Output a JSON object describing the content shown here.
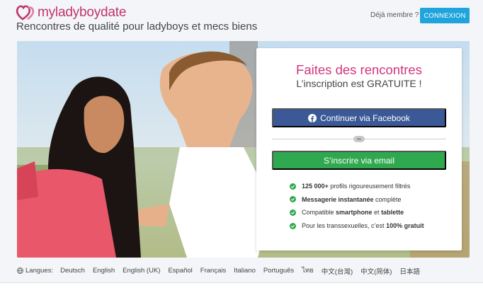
{
  "brand": {
    "name": "myladyboydate",
    "tagline": "Rencontres de qualité pour ladyboys et mecs biens"
  },
  "header": {
    "already_member": "Déjà membre ?",
    "login_button": "CONNEXION"
  },
  "card": {
    "title": "Faites des rencontres",
    "subtitle": "L’inscription est GRATUITE !",
    "facebook_button": "Continuer via Facebook",
    "or_label": "ou",
    "email_button": "S’inscrire via email",
    "features": [
      {
        "bold": "125 000+",
        "text": " profils rigoureusement filtrés"
      },
      {
        "bold": "Messagerie instantanée",
        "text": " complète"
      },
      {
        "pre": "Compatible ",
        "bold": "smartphone",
        "mid": " et ",
        "bold2": "tablette"
      },
      {
        "pre": "Pour les transsexuelles, c’est ",
        "bold": "100% gratuit"
      }
    ]
  },
  "languages": {
    "label": "Langues:",
    "items": [
      "Deutsch",
      "English",
      "English (UK)",
      "Español",
      "Français",
      "Italiano",
      "Português",
      "ไทย",
      "中文(台灣)",
      "中文(简体)",
      "日本語"
    ]
  },
  "colors": {
    "brand_pink": "#d2357d",
    "login_blue": "#1fa4dd",
    "facebook_blue": "#3b5997",
    "email_green": "#2fa84f",
    "check_green": "#2fa84f"
  }
}
